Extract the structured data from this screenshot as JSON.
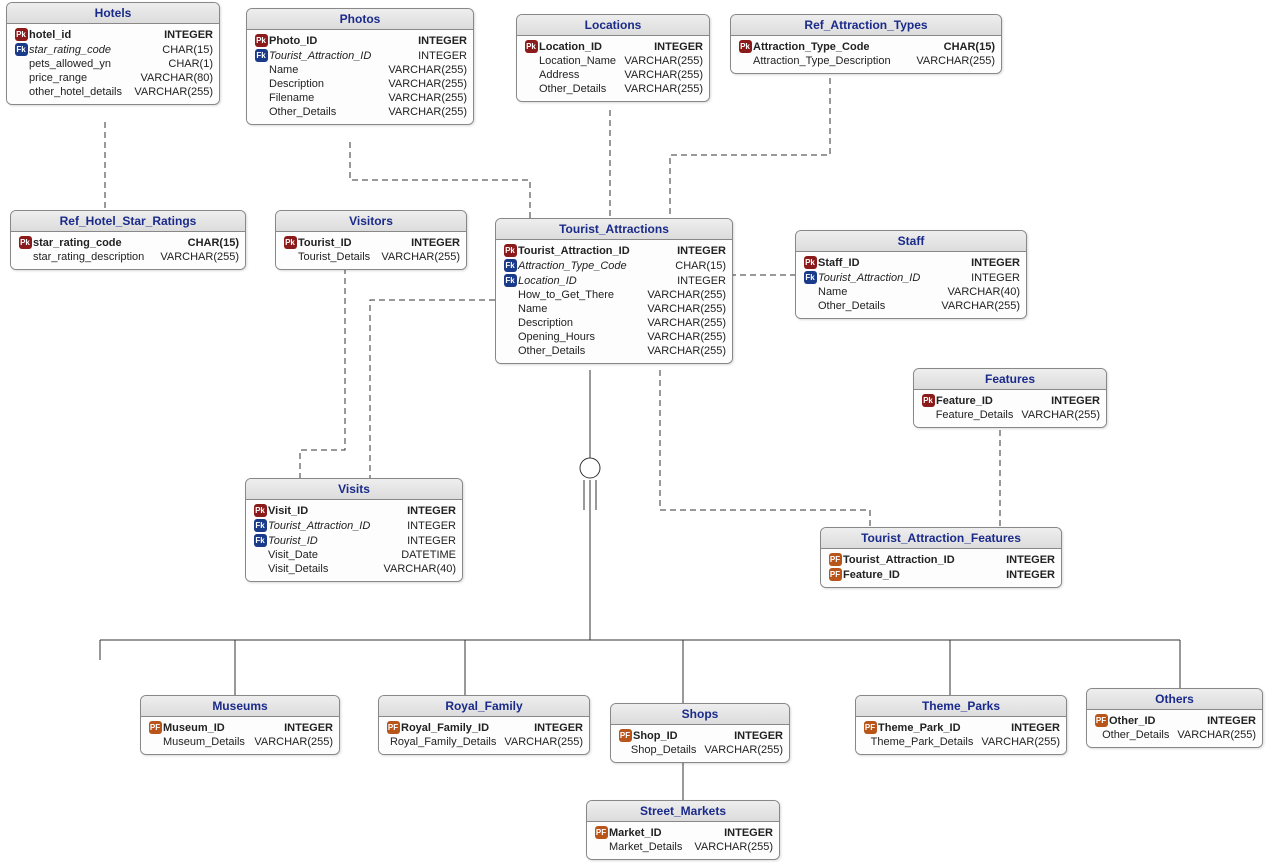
{
  "badges": {
    "pk": "Pk",
    "fk": "Fk",
    "pf": "PF"
  },
  "entities": {
    "hotels": {
      "title": "Hotels",
      "cols": [
        {
          "key": "pk",
          "name": "hotel_id",
          "type": "INTEGER"
        },
        {
          "key": "fk",
          "name": "star_rating_code",
          "type": "CHAR(15)"
        },
        {
          "key": "",
          "name": "pets_allowed_yn",
          "type": "CHAR(1)"
        },
        {
          "key": "",
          "name": "price_range",
          "type": "VARCHAR(80)"
        },
        {
          "key": "",
          "name": "other_hotel_details",
          "type": "VARCHAR(255)"
        }
      ]
    },
    "photos": {
      "title": "Photos",
      "cols": [
        {
          "key": "pk",
          "name": "Photo_ID",
          "type": "INTEGER"
        },
        {
          "key": "fk",
          "name": "Tourist_Attraction_ID",
          "type": "INTEGER"
        },
        {
          "key": "",
          "name": "Name",
          "type": "VARCHAR(255)"
        },
        {
          "key": "",
          "name": "Description",
          "type": "VARCHAR(255)"
        },
        {
          "key": "",
          "name": "Filename",
          "type": "VARCHAR(255)"
        },
        {
          "key": "",
          "name": "Other_Details",
          "type": "VARCHAR(255)"
        }
      ]
    },
    "locations": {
      "title": "Locations",
      "cols": [
        {
          "key": "pk",
          "name": "Location_ID",
          "type": "INTEGER"
        },
        {
          "key": "",
          "name": "Location_Name",
          "type": "VARCHAR(255)"
        },
        {
          "key": "",
          "name": "Address",
          "type": "VARCHAR(255)"
        },
        {
          "key": "",
          "name": "Other_Details",
          "type": "VARCHAR(255)"
        }
      ]
    },
    "ref_attraction_types": {
      "title": "Ref_Attraction_Types",
      "cols": [
        {
          "key": "pk",
          "name": "Attraction_Type_Code",
          "type": "CHAR(15)"
        },
        {
          "key": "",
          "name": "Attraction_Type_Description",
          "type": "VARCHAR(255)"
        }
      ]
    },
    "ref_hotel_star_ratings": {
      "title": "Ref_Hotel_Star_Ratings",
      "cols": [
        {
          "key": "pk",
          "name": "star_rating_code",
          "type": "CHAR(15)"
        },
        {
          "key": "",
          "name": "star_rating_description",
          "type": "VARCHAR(255)"
        }
      ]
    },
    "visitors": {
      "title": "Visitors",
      "cols": [
        {
          "key": "pk",
          "name": "Tourist_ID",
          "type": "INTEGER"
        },
        {
          "key": "",
          "name": "Tourist_Details",
          "type": "VARCHAR(255)"
        }
      ]
    },
    "tourist_attractions": {
      "title": "Tourist_Attractions",
      "cols": [
        {
          "key": "pk",
          "name": "Tourist_Attraction_ID",
          "type": "INTEGER"
        },
        {
          "key": "fk",
          "name": "Attraction_Type_Code",
          "type": "CHAR(15)"
        },
        {
          "key": "fk",
          "name": "Location_ID",
          "type": "INTEGER"
        },
        {
          "key": "",
          "name": "How_to_Get_There",
          "type": "VARCHAR(255)"
        },
        {
          "key": "",
          "name": "Name",
          "type": "VARCHAR(255)"
        },
        {
          "key": "",
          "name": "Description",
          "type": "VARCHAR(255)"
        },
        {
          "key": "",
          "name": "Opening_Hours",
          "type": "VARCHAR(255)"
        },
        {
          "key": "",
          "name": "Other_Details",
          "type": "VARCHAR(255)"
        }
      ]
    },
    "staff": {
      "title": "Staff",
      "cols": [
        {
          "key": "pk",
          "name": "Staff_ID",
          "type": "INTEGER"
        },
        {
          "key": "fk",
          "name": "Tourist_Attraction_ID",
          "type": "INTEGER"
        },
        {
          "key": "",
          "name": "Name",
          "type": "VARCHAR(40)"
        },
        {
          "key": "",
          "name": "Other_Details",
          "type": "VARCHAR(255)"
        }
      ]
    },
    "features": {
      "title": "Features",
      "cols": [
        {
          "key": "pk",
          "name": "Feature_ID",
          "type": "INTEGER"
        },
        {
          "key": "",
          "name": "Feature_Details",
          "type": "VARCHAR(255)"
        }
      ]
    },
    "visits": {
      "title": "Visits",
      "cols": [
        {
          "key": "pk",
          "name": "Visit_ID",
          "type": "INTEGER"
        },
        {
          "key": "fk",
          "name": "Tourist_Attraction_ID",
          "type": "INTEGER"
        },
        {
          "key": "fk",
          "name": "Tourist_ID",
          "type": "INTEGER"
        },
        {
          "key": "",
          "name": "Visit_Date",
          "type": "DATETIME"
        },
        {
          "key": "",
          "name": "Visit_Details",
          "type": "VARCHAR(40)"
        }
      ]
    },
    "tourist_attraction_features": {
      "title": "Tourist_Attraction_Features",
      "cols": [
        {
          "key": "pf",
          "name": "Tourist_Attraction_ID",
          "type": "INTEGER"
        },
        {
          "key": "pf",
          "name": "Feature_ID",
          "type": "INTEGER"
        }
      ]
    },
    "museums": {
      "title": "Museums",
      "cols": [
        {
          "key": "pf",
          "name": "Museum_ID",
          "type": "INTEGER"
        },
        {
          "key": "",
          "name": "Museum_Details",
          "type": "VARCHAR(255)"
        }
      ]
    },
    "royal_family": {
      "title": "Royal_Family",
      "cols": [
        {
          "key": "pf",
          "name": "Royal_Family_ID",
          "type": "INTEGER"
        },
        {
          "key": "",
          "name": "Royal_Family_Details",
          "type": "VARCHAR(255)"
        }
      ]
    },
    "shops": {
      "title": "Shops",
      "cols": [
        {
          "key": "pf",
          "name": "Shop_ID",
          "type": "INTEGER"
        },
        {
          "key": "",
          "name": "Shop_Details",
          "type": "VARCHAR(255)"
        }
      ]
    },
    "theme_parks": {
      "title": "Theme_Parks",
      "cols": [
        {
          "key": "pf",
          "name": "Theme_Park_ID",
          "type": "INTEGER"
        },
        {
          "key": "",
          "name": "Theme_Park_Details",
          "type": "VARCHAR(255)"
        }
      ]
    },
    "others": {
      "title": "Others",
      "cols": [
        {
          "key": "pf",
          "name": "Other_ID",
          "type": "INTEGER"
        },
        {
          "key": "",
          "name": "Other_Details",
          "type": "VARCHAR(255)"
        }
      ]
    },
    "street_markets": {
      "title": "Street_Markets",
      "cols": [
        {
          "key": "pf",
          "name": "Market_ID",
          "type": "INTEGER"
        },
        {
          "key": "",
          "name": "Market_Details",
          "type": "VARCHAR(255)"
        }
      ]
    }
  }
}
